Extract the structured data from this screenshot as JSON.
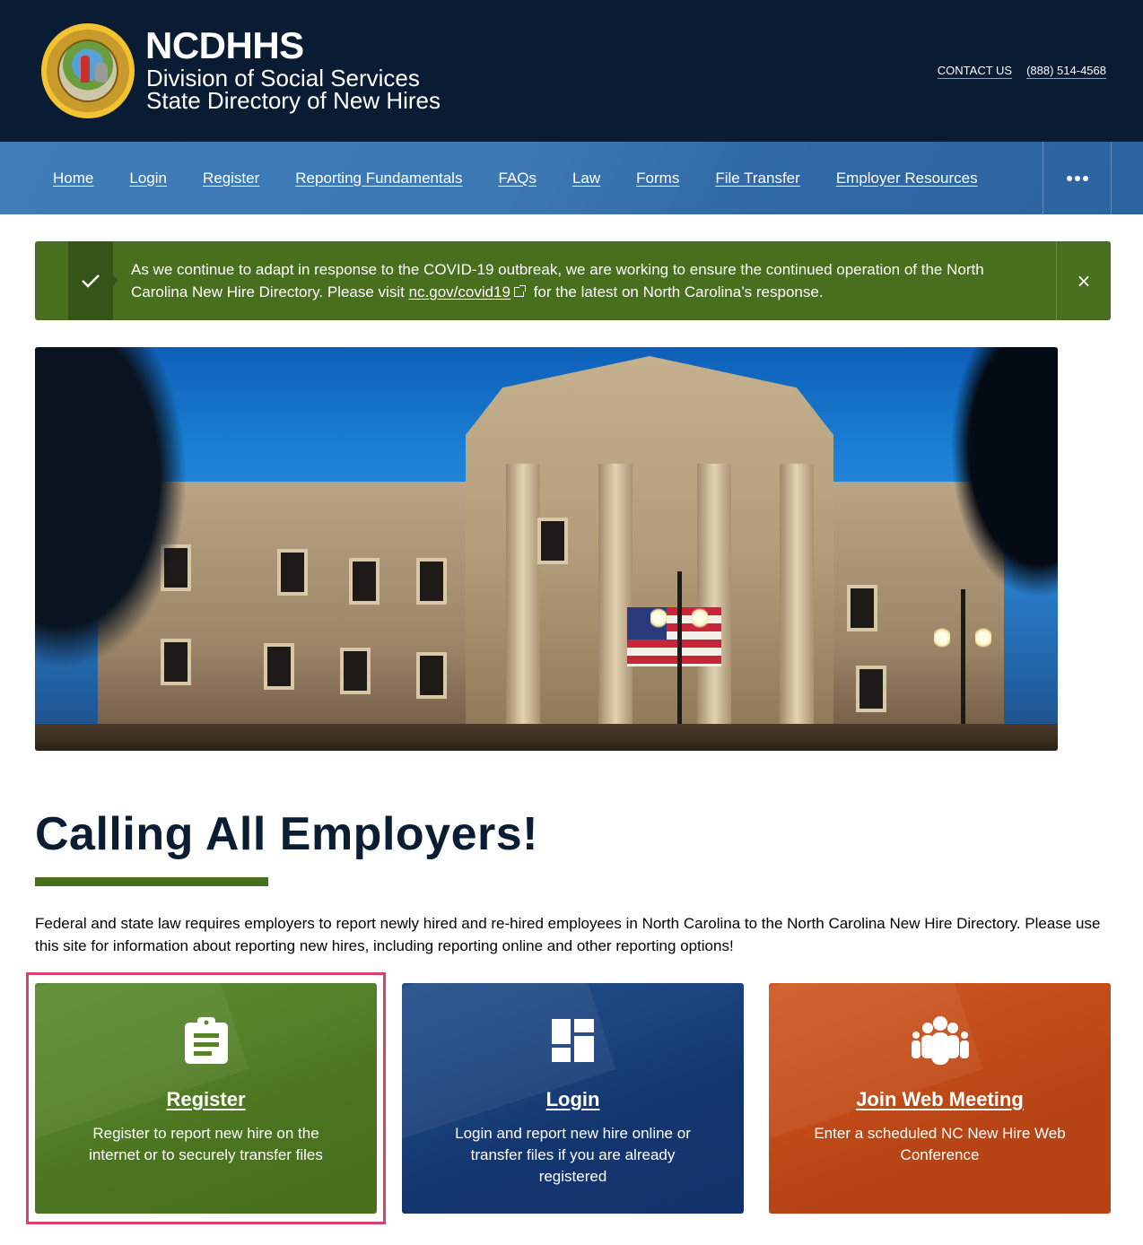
{
  "header": {
    "brand_title": "NCDHHS",
    "brand_line1": "Division of Social Services",
    "brand_line2": "State Directory of New Hires",
    "seal_alt": "The Great Seal of the State of North Carolina",
    "utility_links": [
      {
        "label": "CONTACT US"
      },
      {
        "label": "(888) 514-4568"
      }
    ]
  },
  "nav": {
    "items": [
      {
        "label": "Home"
      },
      {
        "label": "Login"
      },
      {
        "label": "Register"
      },
      {
        "label": "Reporting Fundamentals"
      },
      {
        "label": "FAQs"
      },
      {
        "label": "Law"
      },
      {
        "label": "Forms"
      },
      {
        "label": "File Transfer"
      },
      {
        "label": "Employer Resources"
      }
    ],
    "more_icon": "ellipsis-icon"
  },
  "alert": {
    "icon": "check-icon",
    "text_before": "As we continue to adapt in response to the COVID-19 outbreak, we are working to ensure the continued operation of the North Carolina New Hire Directory. Please visit ",
    "link_label": "nc.gov/covid19",
    "text_after": " for the latest on North Carolina’s response.",
    "close_label": "×",
    "accent_color": "#476f1e"
  },
  "hero": {
    "alt": "North Carolina State Capitol building at dusk"
  },
  "main": {
    "headline": "Calling All Employers!",
    "intro": "Federal and state law requires employers to report newly hired and re-hired employees in North Carolina to the North Carolina New Hire Directory. Please use this site for information about reporting new hires, including reporting online and other reporting options!"
  },
  "cards": [
    {
      "title": "Register",
      "description": "Register to report new hire on the internet or to securely transfer files",
      "icon": "clipboard-icon",
      "color": "#476f1e"
    },
    {
      "title": "Login",
      "description": "Login and report new hire online or transfer files if you are already registered",
      "icon": "dashboard-icon",
      "color": "#13336a"
    },
    {
      "title": "Join Web Meeting",
      "description": "Enter a scheduled NC New Hire Web Conference",
      "icon": "group-icon",
      "color": "#b54313"
    }
  ]
}
